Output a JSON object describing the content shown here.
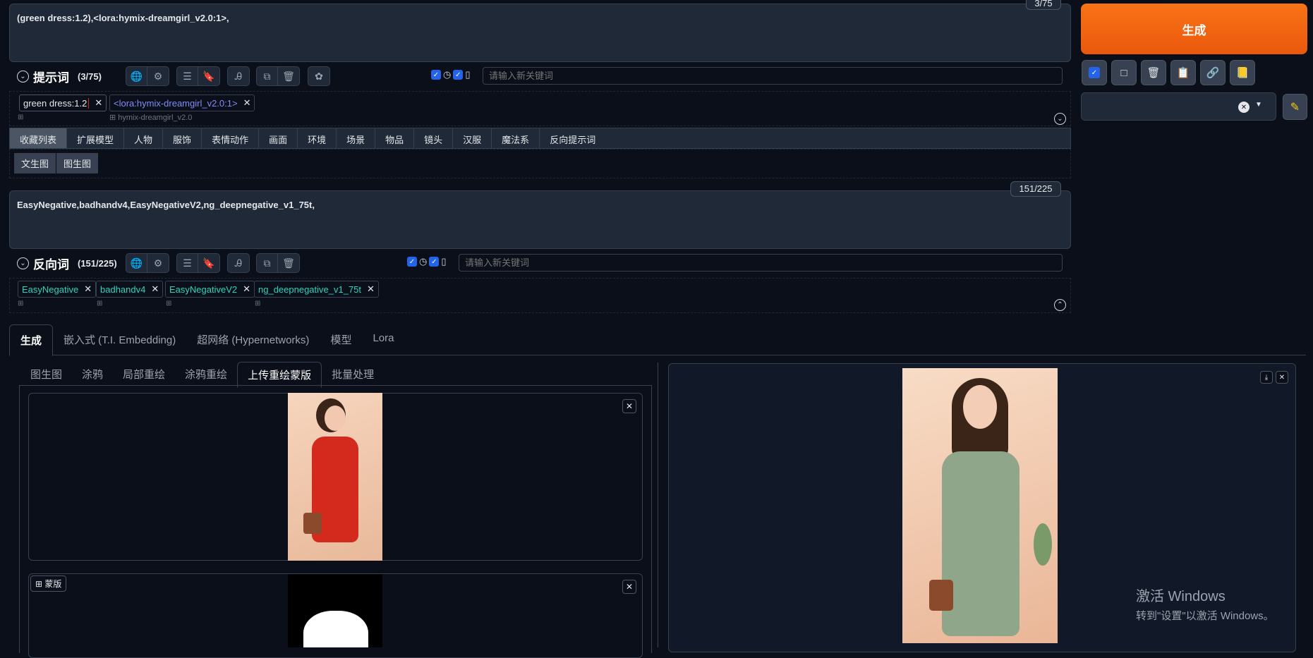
{
  "prompt": {
    "text": "(green dress:1.2),<lora:hymix-dreamgirl_v2.0:1>,",
    "counter": "3/75",
    "label": "提示词",
    "count": "(3/75)",
    "keyword_placeholder": "请输入新关键词",
    "tags": [
      {
        "text": "green dress:1.2",
        "sub": ""
      },
      {
        "text": "<lora:hymix-dreamgirl_v2.0:1>",
        "sub": "hymix-dreamgirl_v2.0"
      }
    ]
  },
  "categories": [
    "收藏列表",
    "扩展模型",
    "人物",
    "服饰",
    "表情动作",
    "画面",
    "环境",
    "场景",
    "物品",
    "镜头",
    "汉服",
    "魔法系",
    "反向提示词"
  ],
  "subcategories": [
    "文生图",
    "图生图"
  ],
  "negative": {
    "text": "EasyNegative,badhandv4,EasyNegativeV2,ng_deepnegative_v1_75t,",
    "counter": "151/225",
    "label": "反向词",
    "count": "(151/225)",
    "keyword_placeholder": "请输入新关键词",
    "tags": [
      "EasyNegative",
      "badhandv4",
      "EasyNegativeV2",
      "ng_deepnegative_v1_75t"
    ]
  },
  "generate_label": "生成",
  "main_tabs": [
    "生成",
    "嵌入式 (T.I. Embedding)",
    "超网络 (Hypernetworks)",
    "模型",
    "Lora"
  ],
  "sub_tabs": [
    "图生图",
    "涂鸦",
    "局部重绘",
    "涂鸦重绘",
    "上传重绘蒙版",
    "批量处理"
  ],
  "mask_label": "蒙版",
  "watermark": {
    "title": "激活 Windows",
    "subtitle": "转到\"设置\"以激活 Windows。"
  },
  "colors": {
    "accent": "#ea580c",
    "bg": "#0b0f19",
    "panel": "#1f2937",
    "tag_teal": "#2dd4bf",
    "tag_blue": "#818cf8"
  }
}
